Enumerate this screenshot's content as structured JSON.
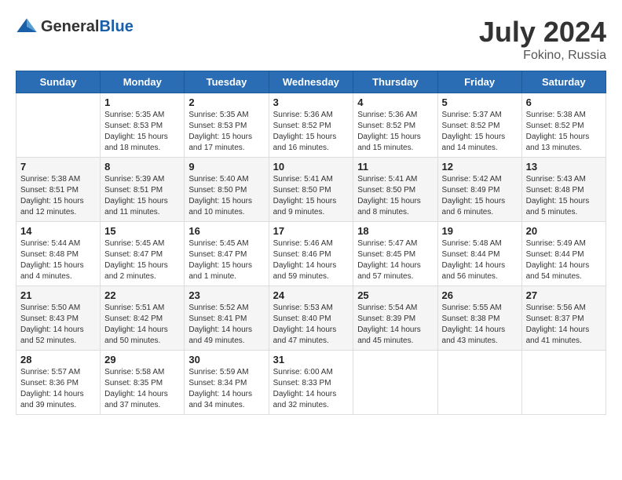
{
  "logo": {
    "general": "General",
    "blue": "Blue"
  },
  "title": {
    "month_year": "July 2024",
    "location": "Fokino, Russia"
  },
  "weekdays": [
    "Sunday",
    "Monday",
    "Tuesday",
    "Wednesday",
    "Thursday",
    "Friday",
    "Saturday"
  ],
  "weeks": [
    [
      {
        "day": "",
        "info": ""
      },
      {
        "day": "1",
        "info": "Sunrise: 5:35 AM\nSunset: 8:53 PM\nDaylight: 15 hours\nand 18 minutes."
      },
      {
        "day": "2",
        "info": "Sunrise: 5:35 AM\nSunset: 8:53 PM\nDaylight: 15 hours\nand 17 minutes."
      },
      {
        "day": "3",
        "info": "Sunrise: 5:36 AM\nSunset: 8:52 PM\nDaylight: 15 hours\nand 16 minutes."
      },
      {
        "day": "4",
        "info": "Sunrise: 5:36 AM\nSunset: 8:52 PM\nDaylight: 15 hours\nand 15 minutes."
      },
      {
        "day": "5",
        "info": "Sunrise: 5:37 AM\nSunset: 8:52 PM\nDaylight: 15 hours\nand 14 minutes."
      },
      {
        "day": "6",
        "info": "Sunrise: 5:38 AM\nSunset: 8:52 PM\nDaylight: 15 hours\nand 13 minutes."
      }
    ],
    [
      {
        "day": "7",
        "info": "Sunrise: 5:38 AM\nSunset: 8:51 PM\nDaylight: 15 hours\nand 12 minutes."
      },
      {
        "day": "8",
        "info": "Sunrise: 5:39 AM\nSunset: 8:51 PM\nDaylight: 15 hours\nand 11 minutes."
      },
      {
        "day": "9",
        "info": "Sunrise: 5:40 AM\nSunset: 8:50 PM\nDaylight: 15 hours\nand 10 minutes."
      },
      {
        "day": "10",
        "info": "Sunrise: 5:41 AM\nSunset: 8:50 PM\nDaylight: 15 hours\nand 9 minutes."
      },
      {
        "day": "11",
        "info": "Sunrise: 5:41 AM\nSunset: 8:50 PM\nDaylight: 15 hours\nand 8 minutes."
      },
      {
        "day": "12",
        "info": "Sunrise: 5:42 AM\nSunset: 8:49 PM\nDaylight: 15 hours\nand 6 minutes."
      },
      {
        "day": "13",
        "info": "Sunrise: 5:43 AM\nSunset: 8:48 PM\nDaylight: 15 hours\nand 5 minutes."
      }
    ],
    [
      {
        "day": "14",
        "info": "Sunrise: 5:44 AM\nSunset: 8:48 PM\nDaylight: 15 hours\nand 4 minutes."
      },
      {
        "day": "15",
        "info": "Sunrise: 5:45 AM\nSunset: 8:47 PM\nDaylight: 15 hours\nand 2 minutes."
      },
      {
        "day": "16",
        "info": "Sunrise: 5:45 AM\nSunset: 8:47 PM\nDaylight: 15 hours\nand 1 minute."
      },
      {
        "day": "17",
        "info": "Sunrise: 5:46 AM\nSunset: 8:46 PM\nDaylight: 14 hours\nand 59 minutes."
      },
      {
        "day": "18",
        "info": "Sunrise: 5:47 AM\nSunset: 8:45 PM\nDaylight: 14 hours\nand 57 minutes."
      },
      {
        "day": "19",
        "info": "Sunrise: 5:48 AM\nSunset: 8:44 PM\nDaylight: 14 hours\nand 56 minutes."
      },
      {
        "day": "20",
        "info": "Sunrise: 5:49 AM\nSunset: 8:44 PM\nDaylight: 14 hours\nand 54 minutes."
      }
    ],
    [
      {
        "day": "21",
        "info": "Sunrise: 5:50 AM\nSunset: 8:43 PM\nDaylight: 14 hours\nand 52 minutes."
      },
      {
        "day": "22",
        "info": "Sunrise: 5:51 AM\nSunset: 8:42 PM\nDaylight: 14 hours\nand 50 minutes."
      },
      {
        "day": "23",
        "info": "Sunrise: 5:52 AM\nSunset: 8:41 PM\nDaylight: 14 hours\nand 49 minutes."
      },
      {
        "day": "24",
        "info": "Sunrise: 5:53 AM\nSunset: 8:40 PM\nDaylight: 14 hours\nand 47 minutes."
      },
      {
        "day": "25",
        "info": "Sunrise: 5:54 AM\nSunset: 8:39 PM\nDaylight: 14 hours\nand 45 minutes."
      },
      {
        "day": "26",
        "info": "Sunrise: 5:55 AM\nSunset: 8:38 PM\nDaylight: 14 hours\nand 43 minutes."
      },
      {
        "day": "27",
        "info": "Sunrise: 5:56 AM\nSunset: 8:37 PM\nDaylight: 14 hours\nand 41 minutes."
      }
    ],
    [
      {
        "day": "28",
        "info": "Sunrise: 5:57 AM\nSunset: 8:36 PM\nDaylight: 14 hours\nand 39 minutes."
      },
      {
        "day": "29",
        "info": "Sunrise: 5:58 AM\nSunset: 8:35 PM\nDaylight: 14 hours\nand 37 minutes."
      },
      {
        "day": "30",
        "info": "Sunrise: 5:59 AM\nSunset: 8:34 PM\nDaylight: 14 hours\nand 34 minutes."
      },
      {
        "day": "31",
        "info": "Sunrise: 6:00 AM\nSunset: 8:33 PM\nDaylight: 14 hours\nand 32 minutes."
      },
      {
        "day": "",
        "info": ""
      },
      {
        "day": "",
        "info": ""
      },
      {
        "day": "",
        "info": ""
      }
    ]
  ]
}
